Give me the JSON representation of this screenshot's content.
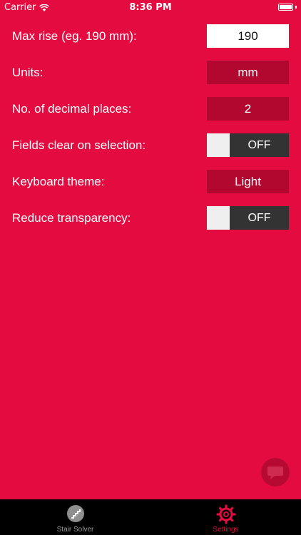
{
  "status_bar": {
    "carrier": "Carrier",
    "time": "8:36 PM"
  },
  "settings": [
    {
      "label": "Max rise (eg. 190 mm):",
      "control": "input",
      "value": "190"
    },
    {
      "label": "Units:",
      "control": "select",
      "value": "mm"
    },
    {
      "label": "No. of decimal places:",
      "control": "select",
      "value": "2"
    },
    {
      "label": "Fields clear on selection:",
      "control": "toggle",
      "value": "OFF"
    },
    {
      "label": "Keyboard theme:",
      "control": "select",
      "value": "Light"
    },
    {
      "label": "Reduce transparency:",
      "control": "toggle",
      "value": "OFF"
    }
  ],
  "fab": {
    "icon": "chat-bubble-icon"
  },
  "tab_bar": {
    "tabs": [
      {
        "label": "Stair Solver",
        "icon": "stairs-icon",
        "active": false
      },
      {
        "label": "Settings",
        "icon": "gear-icon",
        "active": true
      }
    ]
  },
  "colors": {
    "background": "#e30b3f",
    "control_dark": "#b2072f",
    "toggle_track": "#333333",
    "tab_bar": "#000000",
    "tab_active": "#e30b3f",
    "tab_inactive": "#999999"
  }
}
